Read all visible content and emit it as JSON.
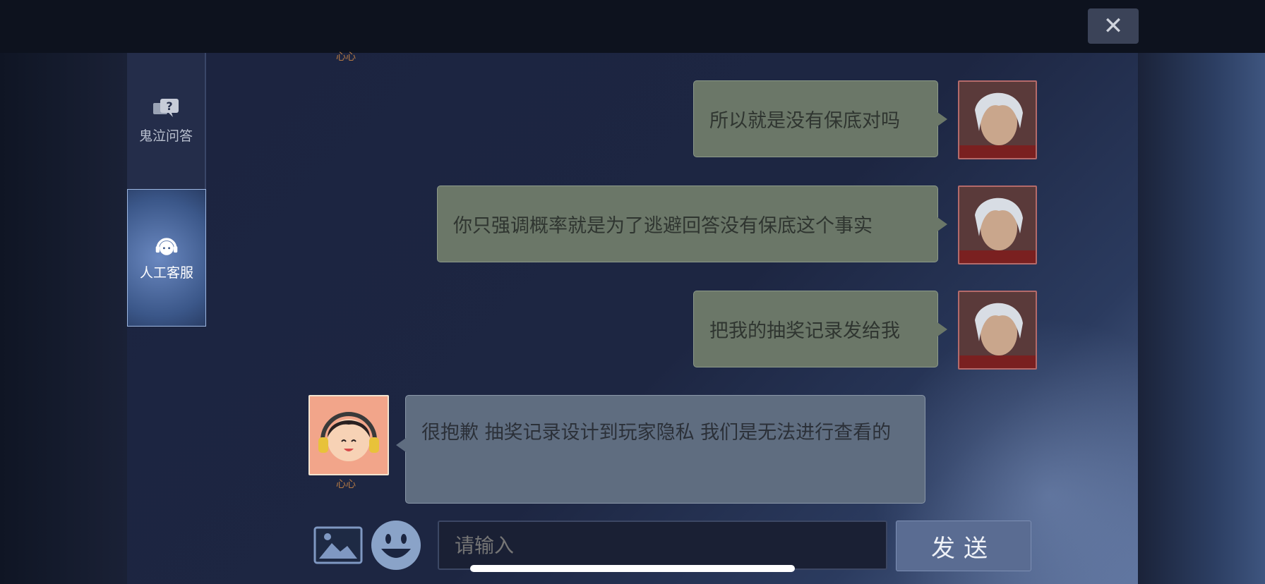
{
  "window": {
    "close_label": "✕"
  },
  "sidebar": {
    "items": [
      {
        "label": "鬼泣问答",
        "icon": "question-chat-icon",
        "active": false
      },
      {
        "label": "人工客服",
        "icon": "headset-icon",
        "active": true
      }
    ]
  },
  "chat": {
    "agent_name": "心心",
    "messages": [
      {
        "from": "user",
        "text": "所以就是没有保底对吗"
      },
      {
        "from": "user",
        "text": "你只强调概率就是为了逃避回答没有保底这个事实"
      },
      {
        "from": "user",
        "text": "把我的抽奖记录发给我"
      },
      {
        "from": "agent",
        "text": "很抱歉 抽奖记录设计到玩家隐私 我们是无法进行查看的"
      }
    ]
  },
  "composer": {
    "image_icon": "image-icon",
    "emoji_icon": "smiley-icon",
    "placeholder": "请输入",
    "send_label": "发送"
  },
  "colors": {
    "user_bubble": "#6b7768",
    "agent_bubble": "#5f6d80",
    "send_button": "#5a6c92",
    "agent_name": "#b67a44"
  }
}
